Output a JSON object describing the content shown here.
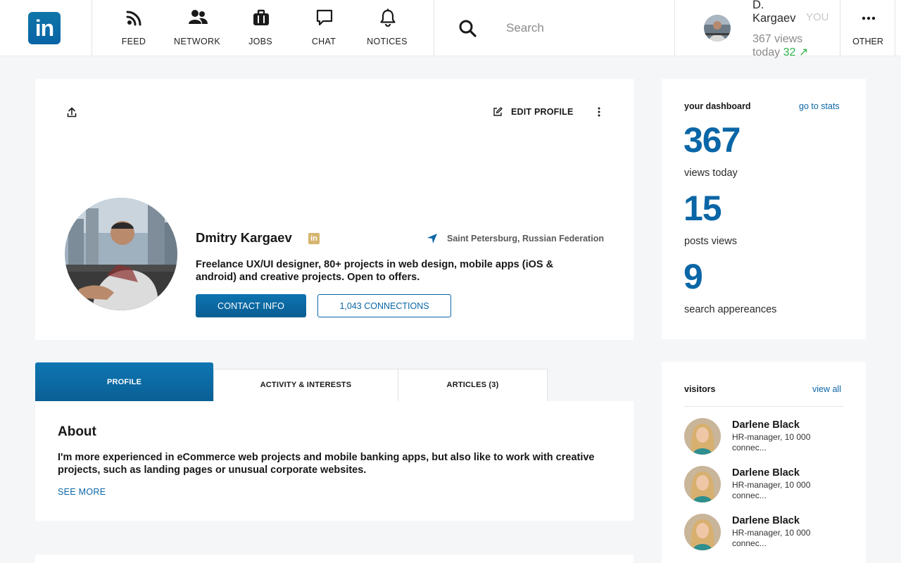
{
  "brand": {
    "logo_text": "in",
    "color": "#0a66c2"
  },
  "nav": {
    "items": [
      {
        "label": "FEED",
        "icon": "rss-icon"
      },
      {
        "label": "NETWORK",
        "icon": "people-icon"
      },
      {
        "label": "JOBS",
        "icon": "briefcase-icon"
      },
      {
        "label": "CHAT",
        "icon": "chat-bubble-icon"
      },
      {
        "label": "NOTICES",
        "icon": "bell-icon"
      }
    ],
    "other_label": "OTHER"
  },
  "search": {
    "placeholder": "Search"
  },
  "me": {
    "name": "D. Kargaev",
    "you_label": "YOU",
    "views_text": "367 views today",
    "views_delta": "32 ↗"
  },
  "profile": {
    "edit_label": "EDIT PROFILE",
    "name": "Dmitry Kargaev",
    "badge": "in",
    "location": "Saint Petersburg, Russian Federation",
    "headline": "Freelance UX/UI designer, 80+ projects in web design, mobile apps (iOS & android) and creative projects. Open to offers.",
    "contact_label": "CONTACT INFO",
    "connections_label": "1,043 CONNECTIONS"
  },
  "tabs": [
    {
      "label": "PROFILE"
    },
    {
      "label": "ACTIVITY & INTERESTS"
    },
    {
      "label": "ARTICLES (3)"
    }
  ],
  "about": {
    "title": "About",
    "text": "I'm more experienced in eCommerce web projects and mobile banking apps, but also like to work with creative projects, such as landing pages or unusual corporate websites.",
    "see_more": "SEE MORE"
  },
  "dashboard": {
    "title": "your dashboard",
    "link": "go to stats",
    "stats": [
      {
        "value": "367",
        "label": "views today"
      },
      {
        "value": "15",
        "label": "posts views"
      },
      {
        "value": "9",
        "label": "search appereances"
      }
    ]
  },
  "visitors": {
    "title": "visitors",
    "link": "view all",
    "list": [
      {
        "name": "Darlene Black",
        "sub": "HR-manager, 10 000 connec..."
      },
      {
        "name": "Darlene Black",
        "sub": "HR-manager, 10 000 connec..."
      },
      {
        "name": "Darlene Black",
        "sub": "HR-manager, 10 000 connec..."
      }
    ]
  }
}
